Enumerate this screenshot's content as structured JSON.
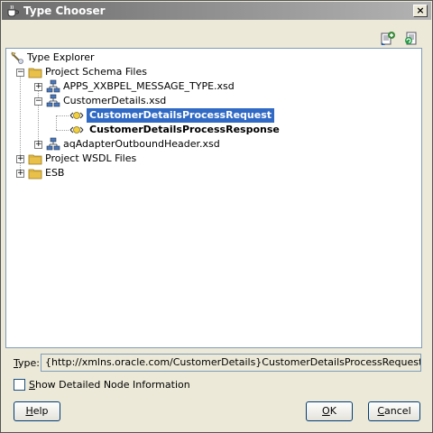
{
  "window": {
    "title": "Type Chooser",
    "close_label": "×"
  },
  "toolbar": {
    "buttons": [
      {
        "icon": "import-schema-icon"
      },
      {
        "icon": "refresh-icon"
      }
    ]
  },
  "tree": {
    "root": "Type Explorer",
    "nodes": [
      {
        "label": "Project Schema Files",
        "icon": "folder-icon"
      },
      {
        "label": "APPS_XXBPEL_MESSAGE_TYPE.xsd",
        "icon": "schema-icon"
      },
      {
        "label": "CustomerDetails.xsd",
        "icon": "schema-icon"
      },
      {
        "label": "CustomerDetailsProcessRequest",
        "icon": "element-icon"
      },
      {
        "label": "CustomerDetailsProcessResponse",
        "icon": "element-icon"
      },
      {
        "label": "aqAdapterOutboundHeader.xsd",
        "icon": "schema-icon"
      },
      {
        "label": "Project WSDL Files",
        "icon": "folder-icon"
      },
      {
        "label": "ESB",
        "icon": "folder-icon"
      }
    ]
  },
  "type_field": {
    "label_prefix": "",
    "label_accel": "T",
    "label_rest": "ype:",
    "value": "{http://xmlns.oracle.com/CustomerDetails}CustomerDetailsProcessRequest"
  },
  "checkbox": {
    "accel": "S",
    "rest": "how Detailed Node Information",
    "checked": false
  },
  "buttons": {
    "help": {
      "accel": "H",
      "rest": "elp"
    },
    "ok": {
      "accel": "O",
      "rest": "K"
    },
    "cancel": {
      "accel": "C",
      "rest": "ancel"
    }
  },
  "colors": {
    "selection": "#316ac5",
    "titlebar": "#8a8a8a",
    "folder": "#e8c04a"
  }
}
